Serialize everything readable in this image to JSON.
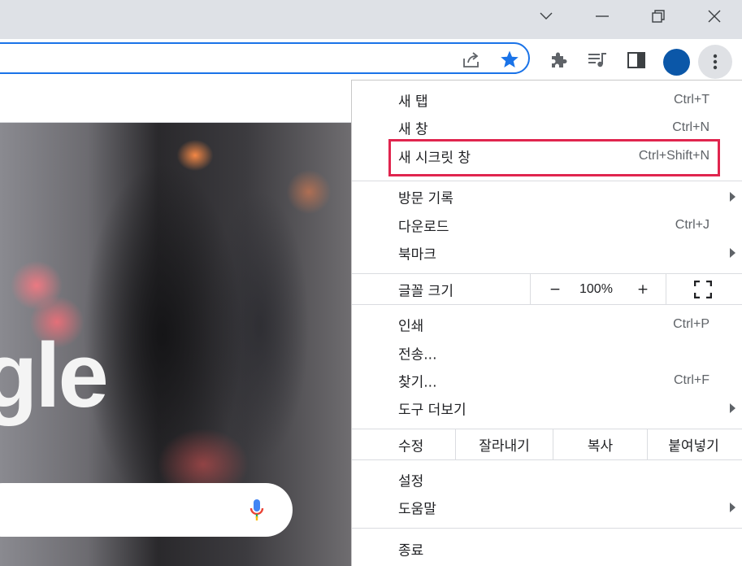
{
  "menu": {
    "new_tab": {
      "label": "새 탭",
      "shortcut": "Ctrl+T"
    },
    "new_window": {
      "label": "새 창",
      "shortcut": "Ctrl+N"
    },
    "incognito": {
      "label": "새 시크릿 창",
      "shortcut": "Ctrl+Shift+N"
    },
    "history": {
      "label": "방문 기록"
    },
    "downloads": {
      "label": "다운로드",
      "shortcut": "Ctrl+J"
    },
    "bookmarks": {
      "label": "북마크"
    },
    "zoom": {
      "label": "글꼴 크기",
      "minus": "−",
      "value": "100%",
      "plus": "+"
    },
    "print": {
      "label": "인쇄",
      "shortcut": "Ctrl+P"
    },
    "cast": {
      "label": "전송..."
    },
    "find": {
      "label": "찾기...",
      "shortcut": "Ctrl+F"
    },
    "more_tools": {
      "label": "도구 더보기"
    },
    "edit": {
      "label": "수정",
      "cut": "잘라내기",
      "copy": "복사",
      "paste": "붙여넣기"
    },
    "settings": {
      "label": "설정"
    },
    "help": {
      "label": "도움말"
    },
    "exit": {
      "label": "종료"
    }
  },
  "page": {
    "logo_text": "gle"
  },
  "colors": {
    "accent": "#1a73e8",
    "highlight": "#e0254e",
    "profile": "#0b57a8"
  }
}
